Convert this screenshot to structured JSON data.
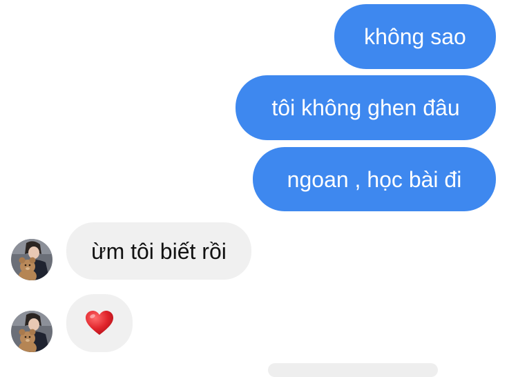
{
  "messages": {
    "sent": [
      {
        "text": "không sao"
      },
      {
        "text": "tôi không ghen đâu"
      },
      {
        "text": "ngoan , học bài đi"
      }
    ],
    "received": [
      {
        "text": "ừm tôi biết rồi"
      },
      {
        "emoji": "red-heart"
      }
    ]
  },
  "colors": {
    "sent_bubble": "#3e88ef",
    "received_bubble": "#f0f0f0",
    "heart": "#e0242b"
  }
}
